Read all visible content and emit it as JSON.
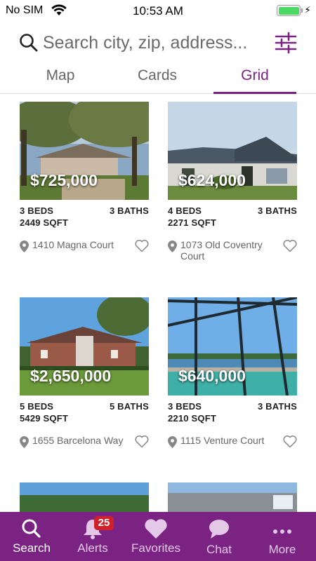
{
  "status_bar": {
    "carrier": "No SIM",
    "time": "10:53 AM"
  },
  "search": {
    "placeholder": "Search city, zip, address..."
  },
  "tabs": [
    {
      "label": "Map"
    },
    {
      "label": "Cards"
    },
    {
      "label": "Grid",
      "active": true
    }
  ],
  "listings": [
    {
      "price": "$725,000",
      "beds": "3 BEDS",
      "baths": "3 BATHS",
      "sqft": "2449 SQFT",
      "address": "1410 Magna Court"
    },
    {
      "price": "$624,000",
      "beds": "4 BEDS",
      "baths": "3 BATHS",
      "sqft": "2271 SQFT",
      "address": "1073 Old Coventry Court"
    },
    {
      "price": "$2,650,000",
      "beds": "5 BEDS",
      "baths": "5 BATHS",
      "sqft": "5429 SQFT",
      "address": "1655 Barcelona Way"
    },
    {
      "price": "$640,000",
      "beds": "3 BEDS",
      "baths": "3 BATHS",
      "sqft": "2210 SQFT",
      "address": "1115 Venture Court"
    }
  ],
  "bottom_nav": [
    {
      "label": "Search",
      "icon": "search-icon",
      "active": true
    },
    {
      "label": "Alerts",
      "icon": "bell-icon",
      "badge": "25"
    },
    {
      "label": "Favorites",
      "icon": "heart-icon"
    },
    {
      "label": "Chat",
      "icon": "chat-bubble-icon"
    },
    {
      "label": "More",
      "icon": "more-dots-icon"
    }
  ],
  "colors": {
    "accent": "#7a2383",
    "badge": "#d0202a",
    "battery": "#4cd964"
  }
}
